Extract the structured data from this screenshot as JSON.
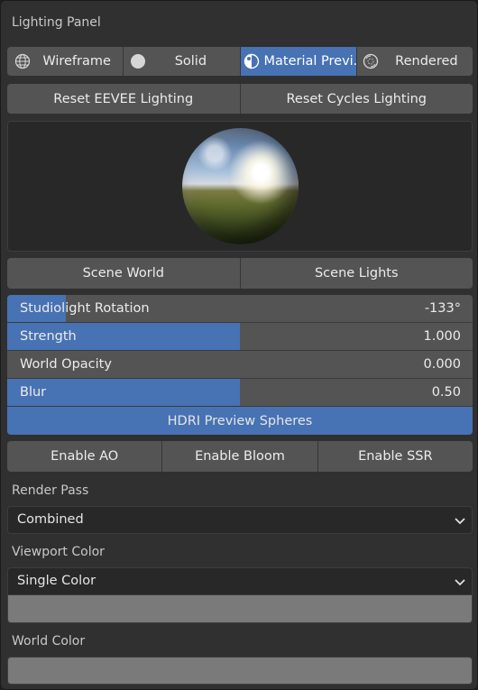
{
  "panel": {
    "title": "Lighting Panel"
  },
  "shading": {
    "wireframe": {
      "label": "Wireframe",
      "icon": "wireframe-globe-icon"
    },
    "solid": {
      "label": "Solid",
      "icon": "solid-circle-icon"
    },
    "material": {
      "label": "Material Previ...",
      "icon": "material-preview-icon",
      "active": true
    },
    "rendered": {
      "label": "Rendered",
      "icon": "rendered-sphere-icon"
    }
  },
  "reset": {
    "eevee": "Reset EEVEE Lighting",
    "cycles": "Reset Cycles Lighting"
  },
  "scene": {
    "world": "Scene World",
    "lights": "Scene Lights"
  },
  "settings": {
    "rotation": {
      "name": "Studiolight Rotation",
      "value": "-133°",
      "fill_fraction": 0.126
    },
    "strength": {
      "name": "Strength",
      "value": "1.000",
      "fill_fraction": 0.5
    },
    "opacity": {
      "name": "World Opacity",
      "value": "0.000",
      "fill_fraction": 0
    },
    "blur": {
      "name": "Blur",
      "value": "0.50",
      "fill_fraction": 0.5
    },
    "hdri": "HDRI Preview Spheres"
  },
  "effects": {
    "ao": "Enable AO",
    "bloom": "Enable Bloom",
    "ssr": "Enable SSR"
  },
  "render_pass": {
    "label": "Render Pass",
    "value": "Combined"
  },
  "viewport_color": {
    "label": "Viewport Color",
    "value": "Single Color",
    "swatch": "#7a7a7a"
  },
  "world_color": {
    "label": "World Color",
    "swatch": "#7a7a7a"
  },
  "colors": {
    "accent": "#4772b3",
    "button": "#545454",
    "panel": "#303030"
  }
}
